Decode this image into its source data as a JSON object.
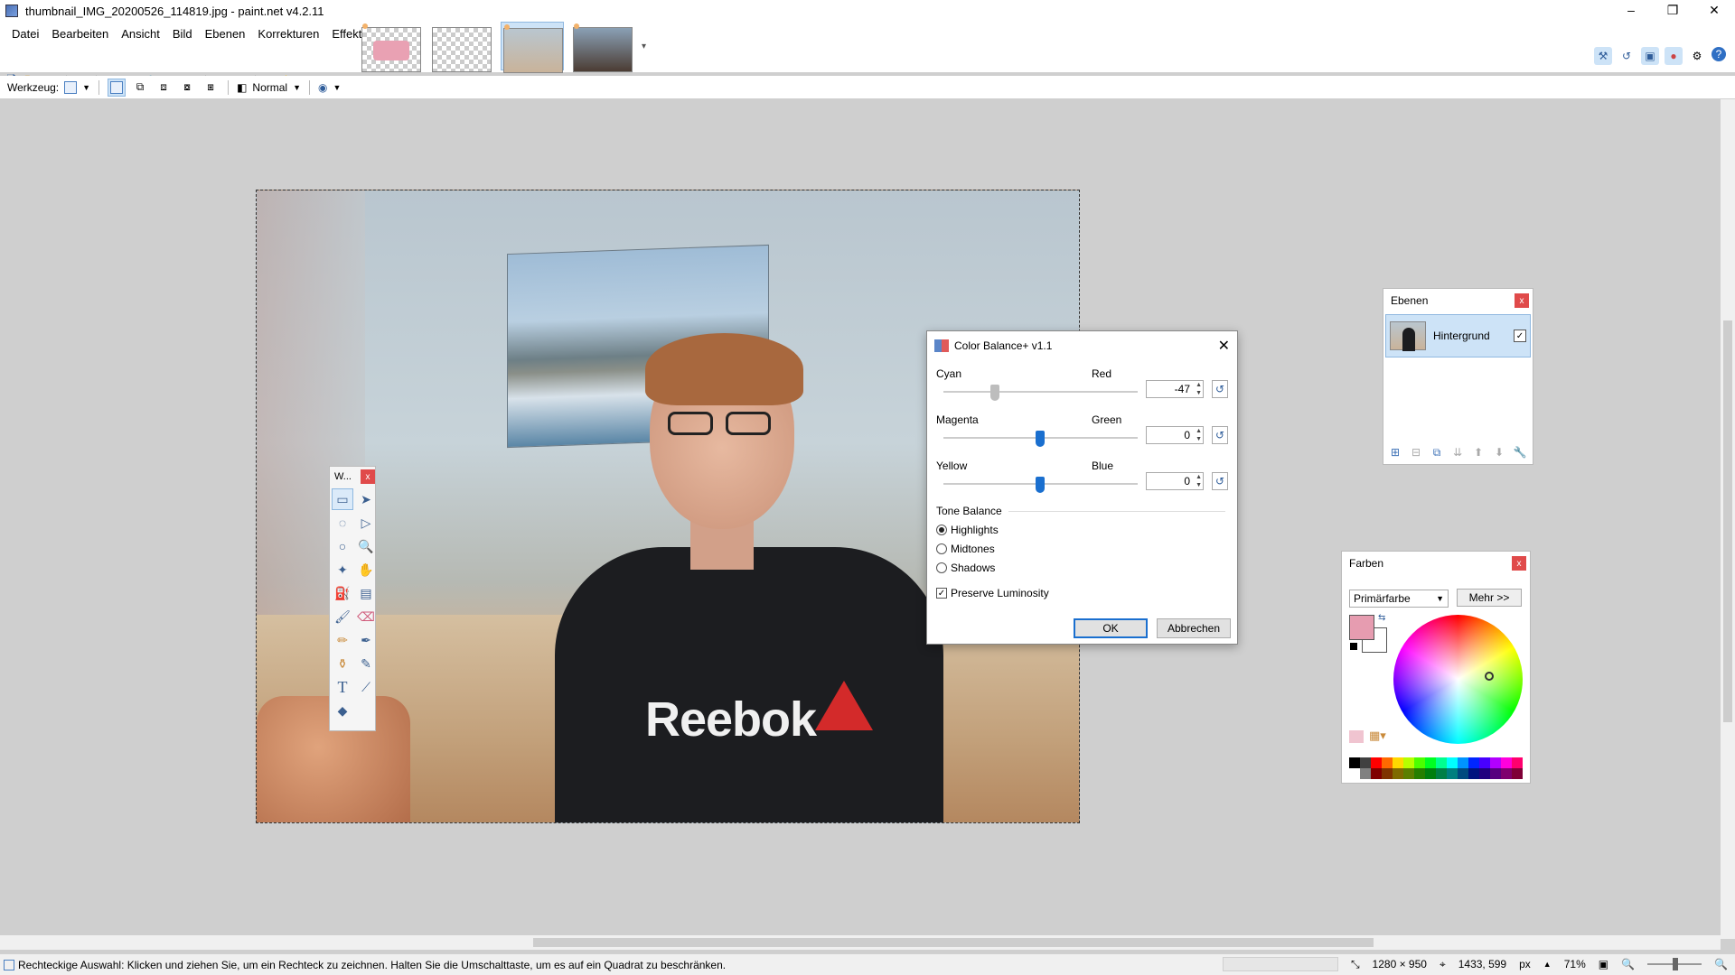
{
  "window": {
    "title": "thumbnail_IMG_20200526_114819.jpg - paint.net v4.2.11",
    "controls": [
      "–",
      "❐",
      "✕"
    ]
  },
  "menu": [
    "Datei",
    "Bearbeiten",
    "Ansicht",
    "Bild",
    "Ebenen",
    "Korrekturen",
    "Effekte"
  ],
  "toolbar2": {
    "tool_label": "Werkzeug:",
    "blend_mode": "Normal"
  },
  "canvas": {
    "shirt_text": "Reebok"
  },
  "tools_window": {
    "title": "W...",
    "close": "x"
  },
  "dialog": {
    "title": "Color Balance+ v1.1",
    "close": "✕",
    "sliders": [
      {
        "left": "Cyan",
        "right": "Red",
        "value": "-47"
      },
      {
        "left": "Magenta",
        "right": "Green",
        "value": "0"
      },
      {
        "left": "Yellow",
        "right": "Blue",
        "value": "0"
      }
    ],
    "tone_balance_label": "Tone Balance",
    "tone_options": [
      "Highlights",
      "Midtones",
      "Shadows"
    ],
    "tone_selected": "Highlights",
    "preserve_luminosity": "Preserve Luminosity",
    "ok": "OK",
    "cancel": "Abbrechen"
  },
  "layers": {
    "title": "Ebenen",
    "close": "x",
    "items": [
      {
        "name": "Hintergrund",
        "visible": true
      }
    ]
  },
  "colors": {
    "title": "Farben",
    "close": "x",
    "selector": "Primärfarbe",
    "more": "Mehr >>",
    "primary": "#e69cb0",
    "secondary": "#ffffff"
  },
  "status": {
    "hint": "Rechteckige Auswahl: Klicken und ziehen Sie, um ein Rechteck zu zeichnen. Halten Sie die Umschalttaste, um es auf ein Quadrat zu beschränken.",
    "image_size": "1280 × 950",
    "cursor_pos": "1433, 599",
    "unit": "px",
    "zoom": "71%"
  }
}
